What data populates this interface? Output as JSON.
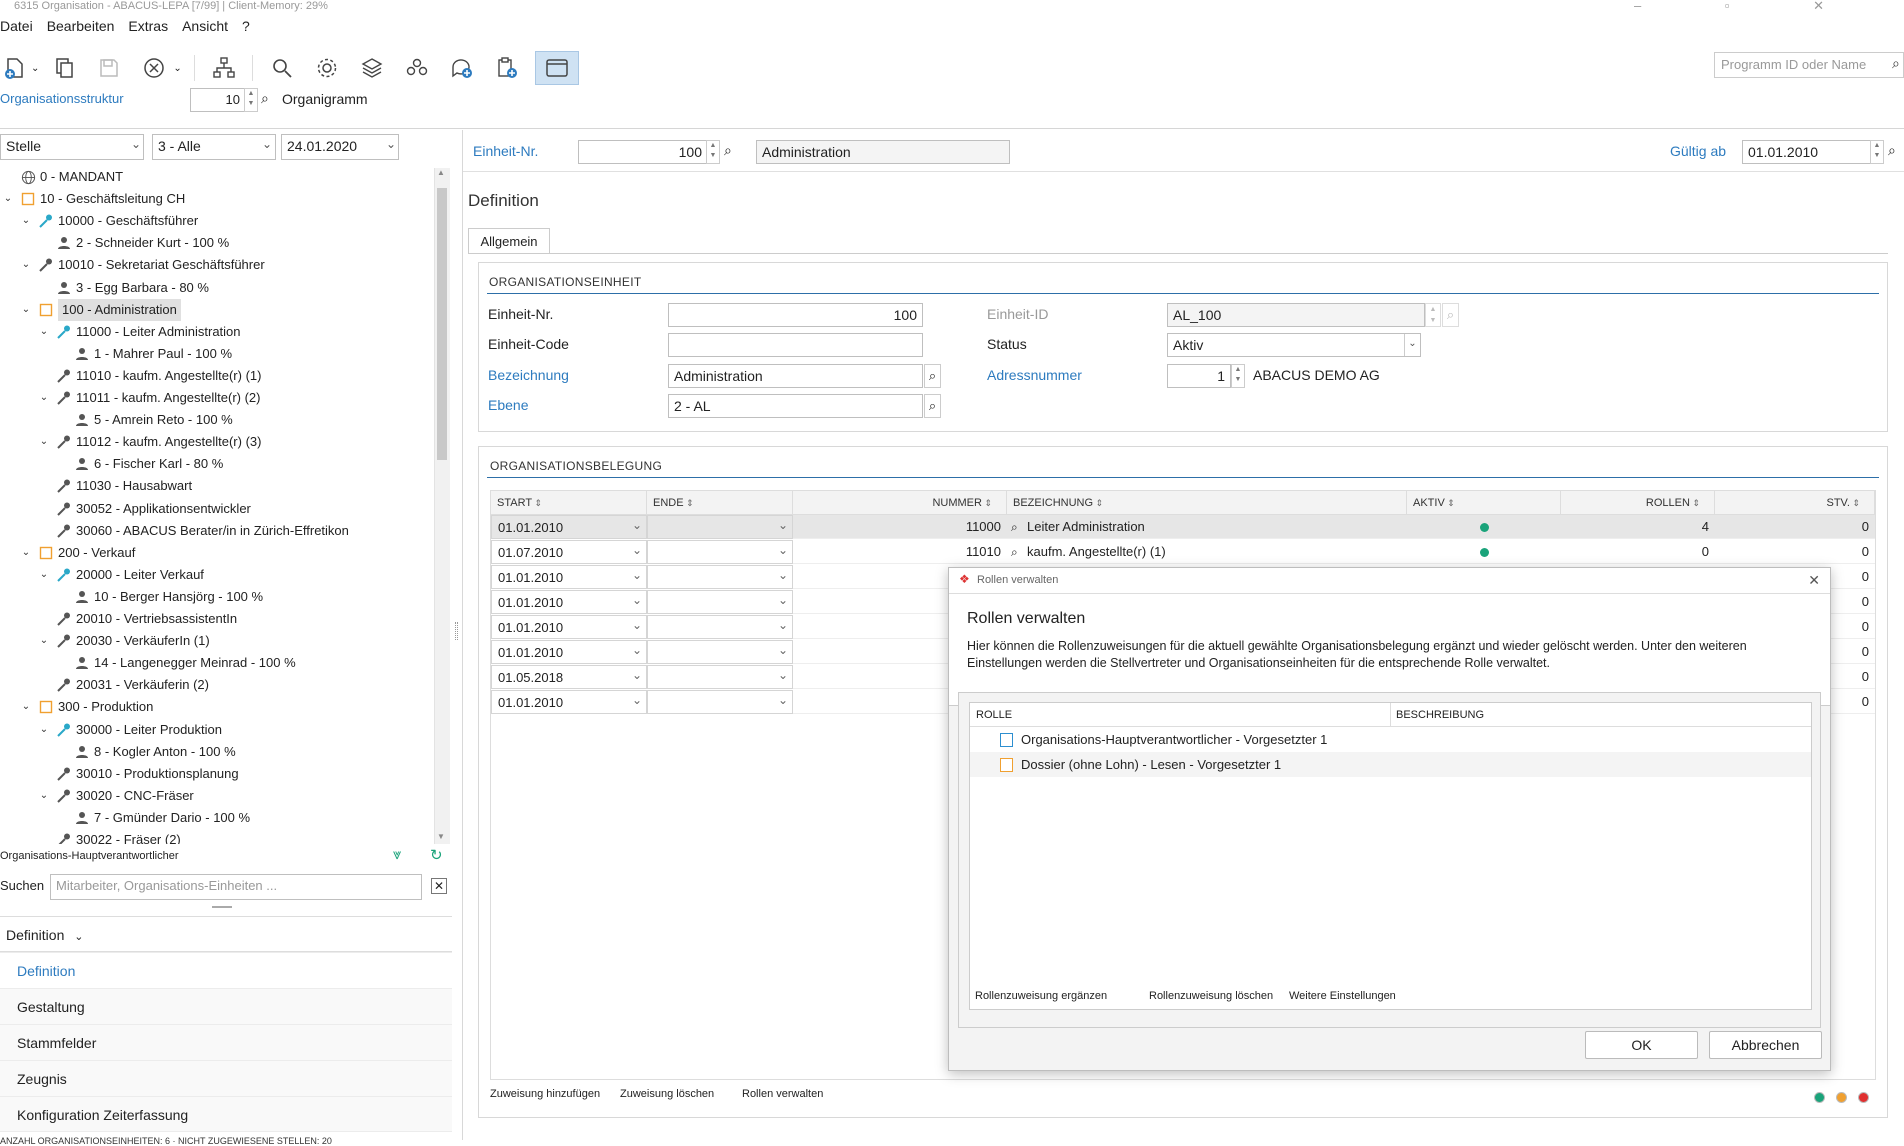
{
  "window": {
    "title": "6315 Organisation - ABACUS-LEPA [7/99] | Client-Memory: 29%"
  },
  "menu": {
    "items": [
      "Datei",
      "Bearbeiten",
      "Extras",
      "Ansicht",
      "?"
    ]
  },
  "toolbar": {
    "program_search_placeholder": "Programm ID oder Name",
    "icons": [
      "new-icon",
      "copy-icon",
      "save-icon",
      "cancel-icon",
      "hierarchy-icon",
      "search-icon",
      "gear-icon",
      "layers-icon",
      "people-icon",
      "chat-add-icon",
      "clipboard-add-icon",
      "window-icon"
    ]
  },
  "org_row": {
    "link": "Organisationsstruktur",
    "number": "10",
    "label": "Organigramm"
  },
  "left": {
    "filter_type": "Stelle",
    "filter_level": "3 - Alle",
    "filter_date": "24.01.2020",
    "tree": [
      {
        "label": "0 - MANDANT",
        "icon": "globe-icon",
        "level": 0,
        "toggle": ""
      },
      {
        "label": "10 - Geschäftsleitung CH",
        "icon": "unit-icon",
        "level": 0,
        "toggle": "v"
      },
      {
        "label": "10000 - Geschäftsführer",
        "icon": "lead-position-icon",
        "level": 1,
        "toggle": "v"
      },
      {
        "label": "2 - Schneider Kurt - 100 %",
        "icon": "person-icon",
        "level": 2,
        "toggle": ""
      },
      {
        "label": "10010 - Sekretariat Geschäftsführer",
        "icon": "position-icon",
        "level": 1,
        "toggle": "v"
      },
      {
        "label": "3 - Egg Barbara - 80 %",
        "icon": "person-icon",
        "level": 2,
        "toggle": ""
      },
      {
        "label": "100 - Administration",
        "icon": "unit-icon",
        "level": 1,
        "toggle": "v",
        "selected": true
      },
      {
        "label": "11000 - Leiter Administration",
        "icon": "lead-position-icon",
        "level": 2,
        "toggle": "v"
      },
      {
        "label": "1 - Mahrer Paul - 100 %",
        "icon": "person-icon",
        "level": 3,
        "toggle": ""
      },
      {
        "label": "11010 - kaufm. Angestellte(r) (1)",
        "icon": "position-icon",
        "level": 2,
        "toggle": ""
      },
      {
        "label": "11011 - kaufm. Angestellte(r) (2)",
        "icon": "position-icon",
        "level": 2,
        "toggle": "v"
      },
      {
        "label": "5 - Amrein Reto - 100 %",
        "icon": "person-icon",
        "level": 3,
        "toggle": ""
      },
      {
        "label": "11012 - kaufm. Angestellte(r) (3)",
        "icon": "position-icon",
        "level": 2,
        "toggle": "v"
      },
      {
        "label": "6 - Fischer Karl - 80 %",
        "icon": "person-icon",
        "level": 3,
        "toggle": ""
      },
      {
        "label": "11030 - Hausabwart",
        "icon": "position-icon",
        "level": 2,
        "toggle": ""
      },
      {
        "label": "30052 - Applikationsentwickler",
        "icon": "position-icon",
        "level": 2,
        "toggle": ""
      },
      {
        "label": "30060 - ABACUS Berater/in in Zürich-Effretikon",
        "icon": "position-icon",
        "level": 2,
        "toggle": ""
      },
      {
        "label": "200 - Verkauf",
        "icon": "unit-icon",
        "level": 1,
        "toggle": "v"
      },
      {
        "label": "20000 - Leiter Verkauf",
        "icon": "lead-position-icon",
        "level": 2,
        "toggle": "v"
      },
      {
        "label": "10 - Berger Hansjörg - 100 %",
        "icon": "person-icon",
        "level": 3,
        "toggle": ""
      },
      {
        "label": "20010 - VertriebsassistentIn",
        "icon": "position-icon",
        "level": 2,
        "toggle": ""
      },
      {
        "label": "20030 - VerkäuferIn (1)",
        "icon": "position-icon",
        "level": 2,
        "toggle": "v"
      },
      {
        "label": "14 - Langenegger Meinrad - 100 %",
        "icon": "person-icon",
        "level": 3,
        "toggle": ""
      },
      {
        "label": "20031 - Verkäuferin (2)",
        "icon": "position-icon",
        "level": 2,
        "toggle": ""
      },
      {
        "label": "300 - Produktion",
        "icon": "unit-icon",
        "level": 1,
        "toggle": "v"
      },
      {
        "label": "30000 - Leiter Produktion",
        "icon": "lead-position-icon",
        "level": 2,
        "toggle": "v"
      },
      {
        "label": "8 - Kogler Anton - 100 %",
        "icon": "person-icon",
        "level": 3,
        "toggle": ""
      },
      {
        "label": "30010 - Produktionsplanung",
        "icon": "position-icon",
        "level": 2,
        "toggle": ""
      },
      {
        "label": "30020 - CNC-Fräser",
        "icon": "position-icon",
        "level": 2,
        "toggle": "v"
      },
      {
        "label": "7 - Gmünder Dario - 100 %",
        "icon": "person-icon",
        "level": 3,
        "toggle": ""
      },
      {
        "label": "30022 - Fräser (2)",
        "icon": "position-icon",
        "level": 2,
        "toggle": ""
      }
    ],
    "tree_footer": "Organisations-Hauptverantwortlicher",
    "search_label": "Suchen",
    "search_placeholder": "Mitarbeiter, Organisations-Einheiten ...",
    "nav_header": "Definition",
    "nav": [
      "Definition",
      "Gestaltung",
      "Stammfelder",
      "Zeugnis",
      "Konfiguration Zeiterfassung"
    ],
    "status": "ANZAHL ORGANISATIONSEINHEITEN: 6 · NICHT ZUGEWIESENE STELLEN: 20"
  },
  "right": {
    "unit_nr_label": "Einheit-Nr.",
    "unit_nr": "100",
    "unit_name": "Administration",
    "valid_from_label": "Gültig ab",
    "valid_from": "01.01.2010",
    "section_title": "Definition",
    "tab": "Allgemein",
    "org_unit": {
      "title": "ORGANISATIONSEINHEIT",
      "nr_label": "Einheit-Nr.",
      "nr": "100",
      "code_label": "Einheit-Code",
      "code": "",
      "name_label": "Bezeichnung",
      "name": "Administration",
      "level_label": "Ebene",
      "level": "2 - AL",
      "id_label": "Einheit-ID",
      "id": "AL_100",
      "status_label": "Status",
      "status": "Aktiv",
      "address_label": "Adressnummer",
      "address_nr": "1",
      "address_name": "ABACUS DEMO AG"
    },
    "assignment": {
      "title": "ORGANISATIONSBELEGUNG",
      "columns": [
        "START",
        "ENDE",
        "NUMMER",
        "BEZEICHNUNG",
        "AKTIV",
        "ROLLEN",
        "STV."
      ],
      "rows": [
        {
          "start": "01.01.2010",
          "end": "",
          "nummer": "11000",
          "bez": "Leiter Administration",
          "aktiv": true,
          "rollen": "4",
          "stv": "0"
        },
        {
          "start": "01.07.2010",
          "end": "",
          "nummer": "11010",
          "bez": "kaufm. Angestellte(r) (1)",
          "aktiv": true,
          "rollen": "0",
          "stv": "0"
        },
        {
          "start": "01.01.2010",
          "end": "",
          "nummer": "",
          "bez": "",
          "aktiv": false,
          "rollen": "",
          "stv": "0"
        },
        {
          "start": "01.01.2010",
          "end": "",
          "nummer": "",
          "bez": "",
          "aktiv": false,
          "rollen": "",
          "stv": "0"
        },
        {
          "start": "01.01.2010",
          "end": "",
          "nummer": "",
          "bez": "",
          "aktiv": false,
          "rollen": "",
          "stv": "0"
        },
        {
          "start": "01.01.2010",
          "end": "",
          "nummer": "",
          "bez": "",
          "aktiv": false,
          "rollen": "",
          "stv": "0"
        },
        {
          "start": "01.05.2018",
          "end": "",
          "nummer": "",
          "bez": "",
          "aktiv": false,
          "rollen": "",
          "stv": "0"
        },
        {
          "start": "01.01.2010",
          "end": "",
          "nummer": "",
          "bez": "",
          "aktiv": false,
          "rollen": "",
          "stv": "0"
        }
      ],
      "actions": [
        "Zuweisung hinzufügen",
        "Zuweisung löschen",
        "Rollen verwalten"
      ],
      "legend_colors": [
        "#1aa37a",
        "#f0a030",
        "#e03030"
      ]
    }
  },
  "dialog": {
    "window_title": "Rollen verwalten",
    "heading": "Rollen verwalten",
    "description": "Hier können die Rollenzuweisungen für die aktuell gewählte Organisationsbelegung ergänzt und wieder gelöscht werden. Unter den weiteren Einstellungen werden die Stellvertreter und Organisationseinheiten für die entsprechende Rolle verwaltet.",
    "columns": [
      "ROLLE",
      "BESCHREIBUNG"
    ],
    "roles": [
      {
        "label": "Organisations-Hauptverantwortlicher - Vorgesetzter 1",
        "color": "#2d8fd0"
      },
      {
        "label": "Dossier (ohne Lohn) - Lesen - Vorgesetzter 1",
        "color": "#f0a030"
      }
    ],
    "actions": [
      "Rollenzuweisung ergänzen",
      "Rollenzuweisung löschen",
      "Weitere Einstellungen"
    ],
    "ok": "OK",
    "cancel": "Abbrechen"
  }
}
